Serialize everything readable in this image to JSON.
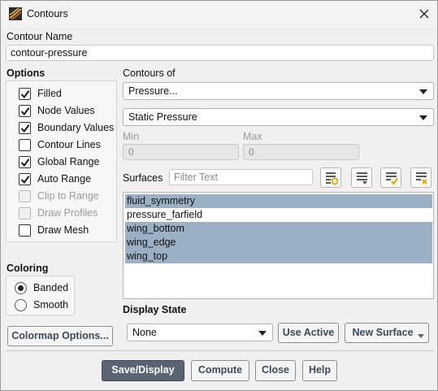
{
  "window": {
    "title": "Contours"
  },
  "contour_name": {
    "label": "Contour Name",
    "value": "contour-pressure"
  },
  "options": {
    "label": "Options",
    "items": [
      {
        "label": "Filled",
        "checked": true,
        "enabled": true
      },
      {
        "label": "Node Values",
        "checked": true,
        "enabled": true
      },
      {
        "label": "Boundary Values",
        "checked": true,
        "enabled": true
      },
      {
        "label": "Contour Lines",
        "checked": false,
        "enabled": true
      },
      {
        "label": "Global Range",
        "checked": true,
        "enabled": true
      },
      {
        "label": "Auto Range",
        "checked": true,
        "enabled": true
      },
      {
        "label": "Clip to Range",
        "checked": false,
        "enabled": false
      },
      {
        "label": "Draw Profiles",
        "checked": false,
        "enabled": false
      },
      {
        "label": "Draw Mesh",
        "checked": false,
        "enabled": true
      }
    ]
  },
  "contours_of": {
    "label": "Contours of",
    "category": "Pressure...",
    "quantity": "Static Pressure"
  },
  "range": {
    "min_label": "Min",
    "min_value": "0",
    "max_label": "Max",
    "max_value": "0"
  },
  "surfaces": {
    "label": "Surfaces",
    "filter_placeholder": "Filter Text",
    "items": [
      {
        "name": "fluid_symmetry",
        "selected": true
      },
      {
        "name": "pressure_farfield",
        "selected": false
      },
      {
        "name": "wing_bottom",
        "selected": true
      },
      {
        "name": "wing_edge",
        "selected": true
      },
      {
        "name": "wing_top",
        "selected": true
      }
    ]
  },
  "coloring": {
    "label": "Coloring",
    "options": [
      {
        "label": "Banded",
        "selected": true
      },
      {
        "label": "Smooth",
        "selected": false
      }
    ]
  },
  "display_state": {
    "label": "Display State",
    "value": "None",
    "use_active": "Use Active",
    "new_surface": "New Surface"
  },
  "buttons": {
    "colormap": "Colormap Options...",
    "save_display": "Save/Display",
    "compute": "Compute",
    "close": "Close",
    "help": "Help"
  },
  "colors": {
    "selection": "#9bb0c4",
    "primary_button": "#5a6472",
    "button_text": "#3a4a5a"
  }
}
